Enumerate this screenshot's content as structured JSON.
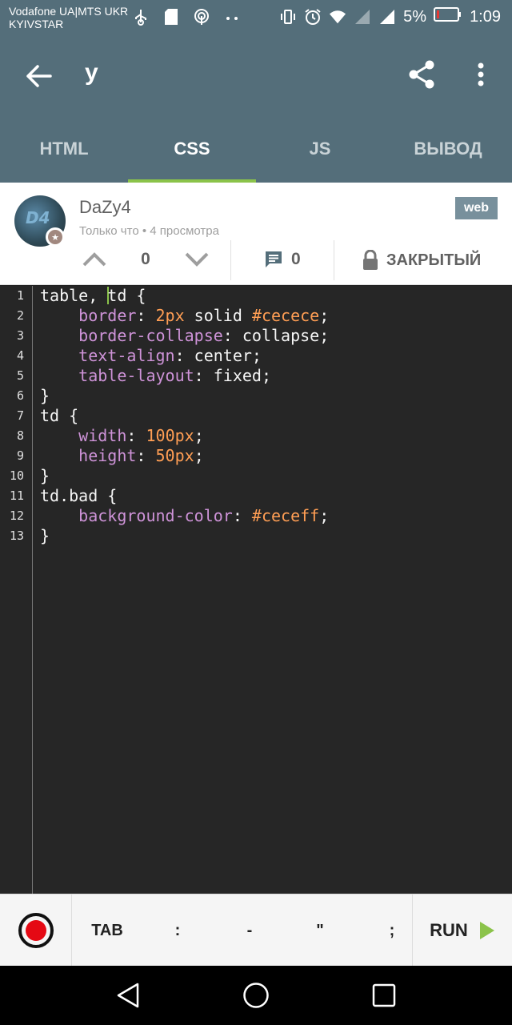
{
  "status_bar": {
    "carrier_line1": "Vodafone UA|MTS UKR",
    "carrier_line2": "KYIVSTAR",
    "battery": "5%",
    "time": "1:09"
  },
  "toolbar": {
    "title": "y",
    "back_icon": "arrow-back-icon",
    "share_icon": "share-icon",
    "more_icon": "more-vert-icon"
  },
  "tabs": [
    {
      "label": "HTML",
      "active": false
    },
    {
      "label": "CSS",
      "active": true
    },
    {
      "label": "JS",
      "active": false
    },
    {
      "label": "ВЫВОД",
      "active": false
    }
  ],
  "post": {
    "avatar_text": "D4",
    "author": "DaZy4",
    "meta": "Только что • 4 просмотра",
    "tag": "web",
    "votes": "0",
    "comments": "0",
    "locked_label": "ЗАКРЫТЫЙ"
  },
  "editor": {
    "lines": [
      {
        "n": "1"
      },
      {
        "n": "2"
      },
      {
        "n": "3"
      },
      {
        "n": "4"
      },
      {
        "n": "5"
      },
      {
        "n": "6"
      },
      {
        "n": "7"
      },
      {
        "n": "8"
      },
      {
        "n": "9"
      },
      {
        "n": "10"
      },
      {
        "n": "11"
      },
      {
        "n": "12"
      },
      {
        "n": "13"
      }
    ],
    "code": {
      "l1a": "table, ",
      "l1b": "td {",
      "l2p": "border",
      "l2a": ": ",
      "l2n": "2px",
      "l2b": " solid ",
      "l2h": "#cecece",
      "l2c": ";",
      "l3p": "border-collapse",
      "l3a": ": collapse;",
      "l4p": "text-align",
      "l4a": ": center;",
      "l5p": "table-layout",
      "l5a": ": fixed;",
      "l6": "}",
      "l7": "td {",
      "l8p": "width",
      "l8a": ": ",
      "l8n": "100px",
      "l8c": ";",
      "l9p": "height",
      "l9a": ": ",
      "l9n": "50px",
      "l9c": ";",
      "l10": "}",
      "l11": "td.bad {",
      "l12p": "background-color",
      "l12a": ": ",
      "l12h": "#ceceff",
      "l12c": ";",
      "l13": "}"
    }
  },
  "keybar": {
    "keys": [
      "TAB",
      ":",
      "-",
      "\"",
      ";"
    ],
    "run_label": "RUN"
  },
  "colors": {
    "primary": "#546e7a",
    "accent": "#8bc34a",
    "editor_bg": "#262626",
    "property": "#ce93d8",
    "number": "#ff9e54",
    "record": "#e50914",
    "run": "#8bc34a"
  }
}
